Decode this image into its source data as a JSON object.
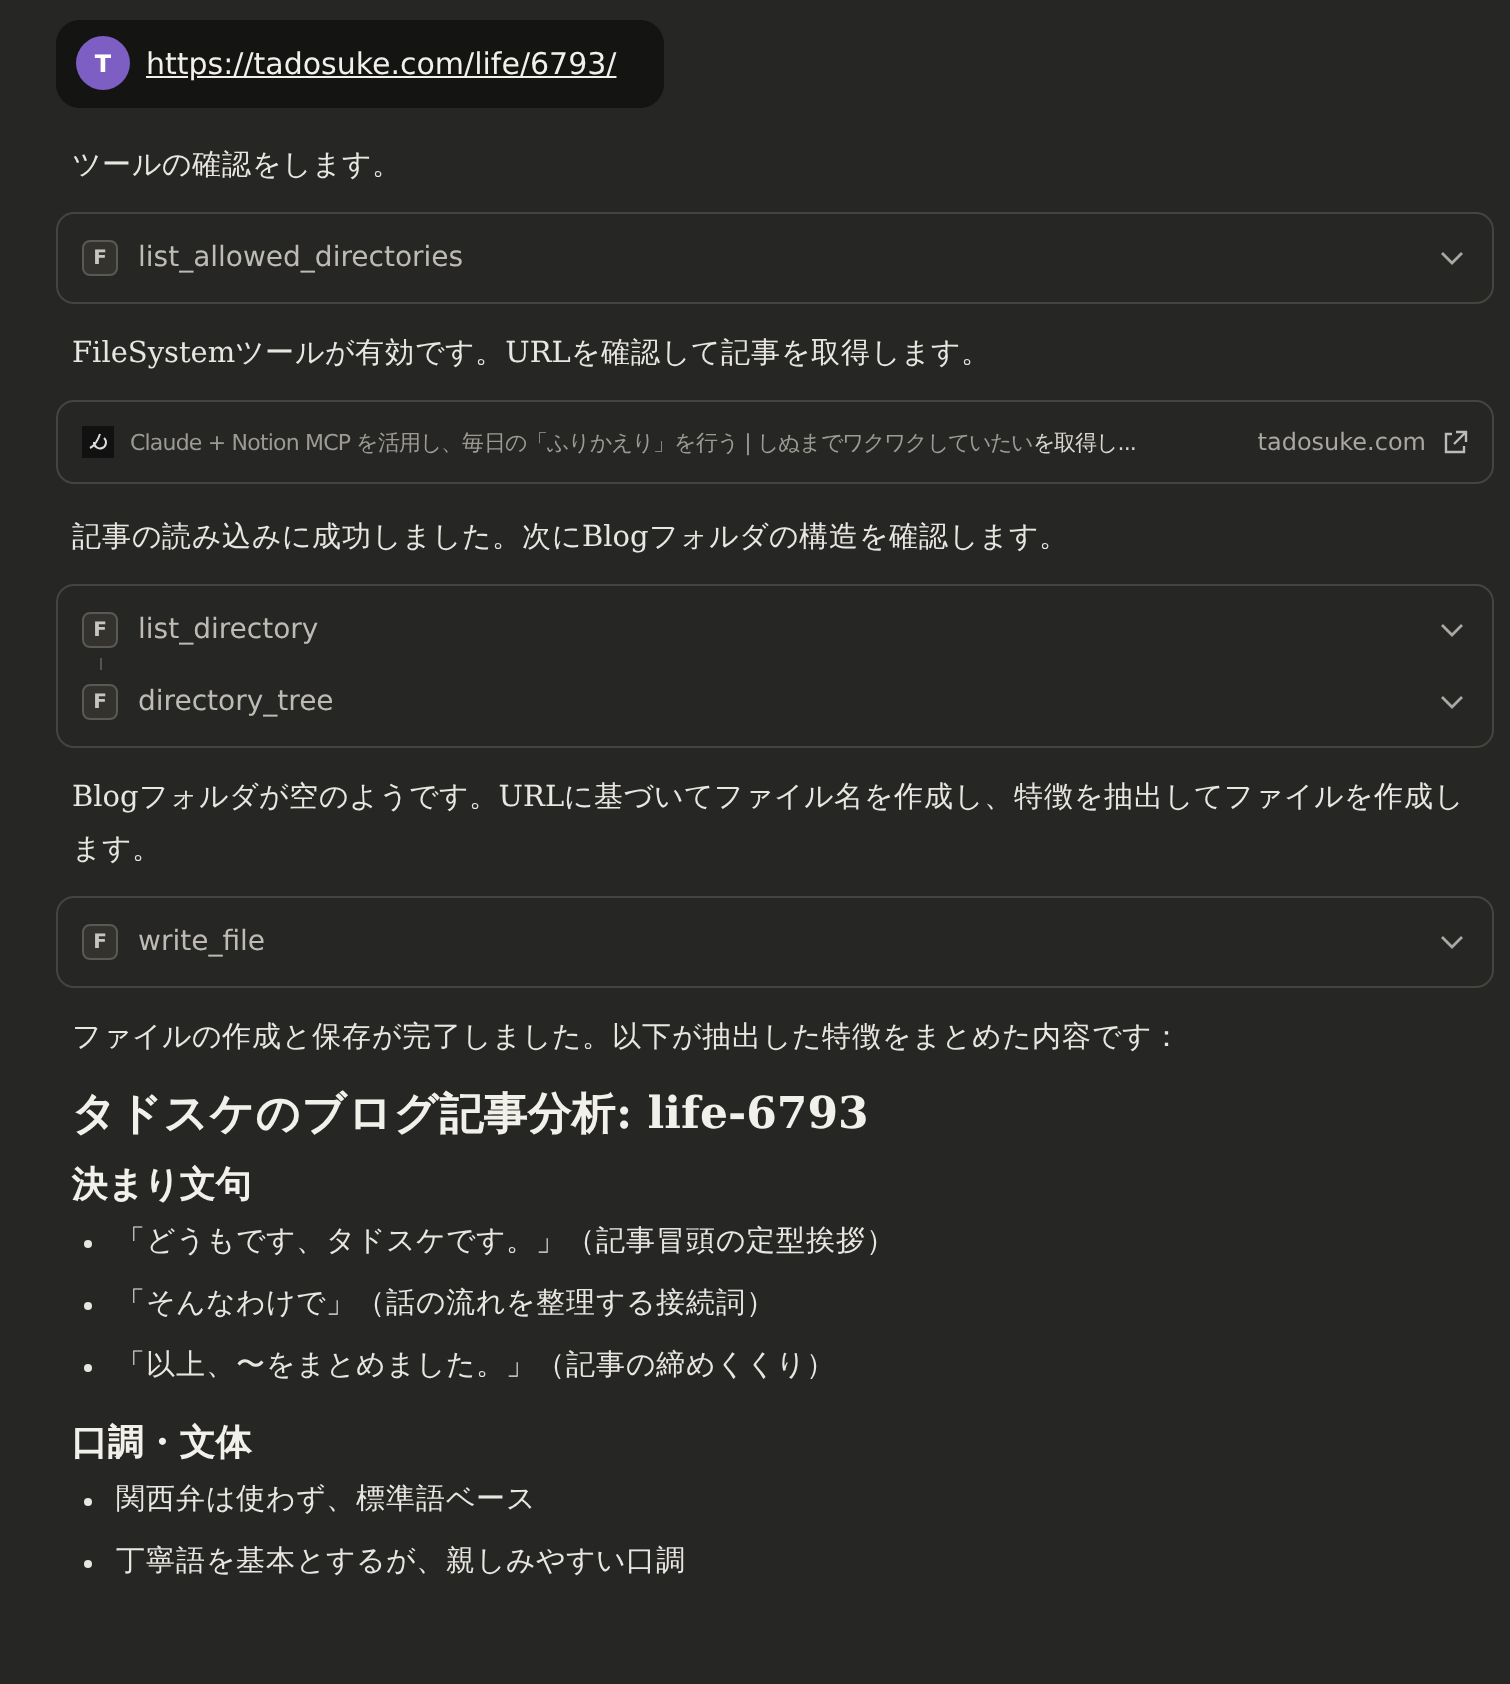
{
  "content": [
    {
      "kind": "user",
      "avatar": "T",
      "link": "https://tadosuke.com/life/6793/"
    },
    {
      "kind": "text",
      "text": "ツールの確認をします。"
    },
    {
      "kind": "tools",
      "items": [
        {
          "badge": "F",
          "name": "list_allowed_directories",
          "expanded": false
        }
      ]
    },
    {
      "kind": "text",
      "text": "FileSystemツールが有効です。URLを確認して記事を取得します。"
    },
    {
      "kind": "link",
      "title": "Claude + Notion MCP を活用し、毎日の「ふりかえり」を行う | しぬまでワクワクしていたい",
      "suffix": "を取得し...",
      "domain": "tadosuke.com"
    },
    {
      "kind": "text",
      "text": "記事の読み込みに成功しました。次にBlogフォルダの構造を確認します。"
    },
    {
      "kind": "tools",
      "items": [
        {
          "badge": "F",
          "name": "list_directory",
          "expanded": false
        },
        {
          "badge": "F",
          "name": "directory_tree",
          "expanded": false
        }
      ]
    },
    {
      "kind": "text",
      "text": "Blogフォルダが空のようです。URLに基づいてファイル名を作成し、特徴を抽出してファイルを作成します。"
    },
    {
      "kind": "tools",
      "items": [
        {
          "badge": "F",
          "name": "write_file",
          "expanded": false
        }
      ]
    },
    {
      "kind": "text",
      "text": "ファイルの作成と保存が完了しました。以下が抽出した特徴をまとめた内容です："
    },
    {
      "kind": "heading",
      "text": "タドスケのブログ記事分析: life-6793"
    },
    {
      "kind": "subheading",
      "text": "決まり文句"
    },
    {
      "kind": "bullets",
      "items": [
        "「どうもです、タドスケです。」（記事冒頭の定型挨拶）",
        "「そんなわけで」（話の流れを整理する接続詞）",
        "「以上、〜をまとめました。」（記事の締めくくり）"
      ]
    },
    {
      "kind": "subheading",
      "text": "口調・文体"
    },
    {
      "kind": "bullets",
      "items": [
        "関西弁は使わず、標準語ベース",
        "丁寧語を基本とするが、親しみやすい口調"
      ]
    }
  ]
}
